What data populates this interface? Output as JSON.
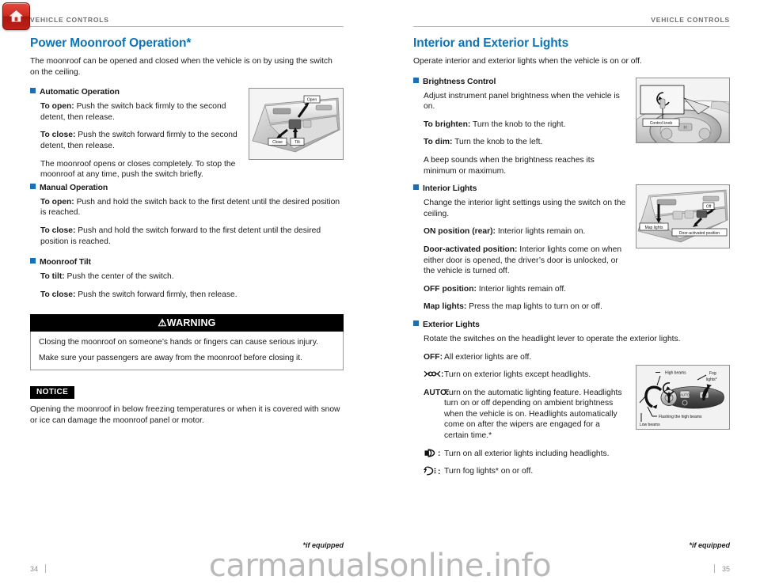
{
  "watermark": "carmanualsonline.info",
  "colors": {
    "heading_blue": "#0c74b8",
    "marker_blue": "#1b6fb5",
    "runhead_gray": "#6e6e6e",
    "folio_gray": "#8d8d8d",
    "home_icon_red": "#cf2a20"
  },
  "left_page": {
    "running_head": "VEHICLE CONTROLS",
    "title": "Power Moonroof Operation*",
    "lead": "The moonroof can be opened and closed when the vehicle is on by using the switch on the ceiling.",
    "sections": [
      {
        "label": "Automatic Operation",
        "paragraphs": [
          {
            "lead_in": "To open:",
            "text": " Push the switch back firmly to the second detent, then release."
          },
          {
            "lead_in": "To close:",
            "text": " Push the switch forward firmly to the second detent, then release."
          },
          {
            "lead_in": "",
            "text": "The moonroof opens or closes completely. To stop the moonroof at any time, push the switch briefly."
          }
        ]
      },
      {
        "label": "Manual Operation",
        "paragraphs": [
          {
            "lead_in": "To open:",
            "text": " Push and hold the switch back to the first detent until the desired position is reached."
          },
          {
            "lead_in": "To close:",
            "text": " Push and hold the switch forward  to the first detent until the desired position is reached."
          }
        ]
      },
      {
        "label": "Moonroof Tilt",
        "paragraphs": [
          {
            "lead_in": "To tilt:",
            "text": " Push the center of the switch."
          },
          {
            "lead_in": "To close:",
            "text": " Push the switch forward firmly, then release."
          }
        ]
      }
    ],
    "figure_moonroof": {
      "name": "moonroof-switch-illustration",
      "labels": [
        "Open",
        "Close",
        "Tilt"
      ]
    },
    "warning": {
      "heading": "WARNING",
      "lines": [
        "Closing the moonroof on someone’s hands or fingers can cause serious injury.",
        "Make sure your passengers are away from the moonroof before closing it."
      ]
    },
    "notice": {
      "tag": "NOTICE",
      "text": "Opening the moonroof in below freezing temperatures or when it is covered with snow or ice can damage the moonroof panel or motor."
    },
    "footnote": "*if equipped",
    "folio": "34"
  },
  "right_page": {
    "running_head": "VEHICLE CONTROLS",
    "title": "Interior and Exterior Lights",
    "lead": "Operate interior and exterior lights when the vehicle is on or off.",
    "brightness": {
      "label": "Brightness Control",
      "paragraphs": [
        {
          "lead_in": "",
          "text": "Adjust instrument panel brightness when the vehicle is on."
        },
        {
          "lead_in": "To brighten:",
          "text": " Turn the knob to the right."
        },
        {
          "lead_in": "To dim:",
          "text": " Turn the knob to the left."
        },
        {
          "lead_in": "",
          "text": "A beep sounds when the brightness reaches its minimum or maximum."
        }
      ],
      "figure": {
        "name": "brightness-control-illustration",
        "labels": [
          "Control knob"
        ]
      }
    },
    "interior": {
      "label": "Interior Lights",
      "paragraphs": [
        {
          "lead_in": "",
          "text": "Change the interior light settings using the switch on the ceiling."
        },
        {
          "lead_in": "ON position (rear):",
          "text": " Interior lights remain on."
        },
        {
          "lead_in": "Door-activated position:",
          "text": " Interior lights come on when either door is opened, the driver’s door is unlocked, or the vehicle is turned off."
        },
        {
          "lead_in": "OFF position:",
          "text": " Interior lights remain off."
        },
        {
          "lead_in": "Map lights:",
          "text": " Press the map lights to turn on or off."
        }
      ],
      "figure": {
        "name": "interior-lights-illustration",
        "labels": [
          "Map lights",
          "Off",
          "Door-activated position"
        ]
      }
    },
    "exterior": {
      "label": "Exterior Lights",
      "lead": "Rotate the switches on the headlight lever to operate the exterior lights.",
      "items": [
        {
          "symbol": "OFF:",
          "symbol_kind": "text",
          "text": "All exterior lights are off."
        },
        {
          "symbol": "",
          "symbol_kind": "position-lamp-icon",
          "text": "Turn on exterior lights except headlights."
        },
        {
          "symbol": "AUTO:",
          "symbol_kind": "text",
          "text": "Turn on the automatic lighting feature. Headlights turn on or off depending on ambient brightness when the vehicle is on. Headlights automatically come on after the wipers are engaged for a certain time.*"
        },
        {
          "symbol": "",
          "symbol_kind": "headlight-icon",
          "text": "Turn on all exterior lights including headlights."
        },
        {
          "symbol": "",
          "symbol_kind": "fog-light-icon",
          "text": "Turn fog lights* on or off."
        }
      ],
      "figure": {
        "name": "headlight-lever-illustration",
        "labels": [
          "High beams",
          "Fog lights*",
          "Flashing the high beams",
          "Low beams"
        ]
      }
    },
    "footnote": "*if equipped",
    "folio": "35"
  }
}
